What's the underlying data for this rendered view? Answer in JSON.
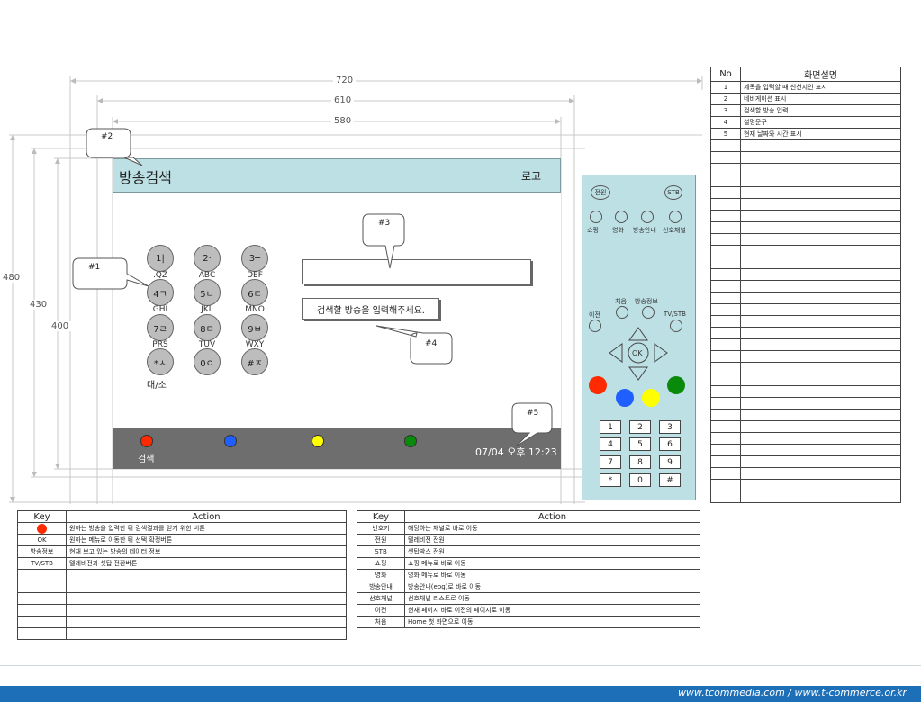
{
  "dimensions": {
    "w720": "720",
    "w610": "610",
    "w580": "580",
    "h480": "480",
    "h430": "430",
    "h400": "400"
  },
  "callouts": {
    "c1": "#1",
    "c2": "#2",
    "c3": "#3",
    "c4": "#4",
    "c5": "#5"
  },
  "screen": {
    "title": "방송검색",
    "logo": "로고",
    "keypad": [
      {
        "key": "1|",
        "sub": ".QZ"
      },
      {
        "key": "2·",
        "sub": "ABC"
      },
      {
        "key": "3─",
        "sub": "DEF"
      },
      {
        "key": "4ㄱ",
        "sub": "GHI"
      },
      {
        "key": "5ㄴ",
        "sub": "JKL"
      },
      {
        "key": "6ㄷ",
        "sub": "MNO"
      },
      {
        "key": "7ㄹ",
        "sub": "PRS"
      },
      {
        "key": "8ㅁ",
        "sub": "TUV"
      },
      {
        "key": "9ㅂ",
        "sub": "WXY"
      },
      {
        "key": "*ㅅ",
        "sub": ""
      },
      {
        "key": "0ㅇ",
        "sub": ""
      },
      {
        "key": "#ㅈ",
        "sub": ""
      }
    ],
    "case_toggle": "대/소",
    "input_value": "",
    "guide_text": "검색할 방송을 입력해주세요.",
    "footer_search_label": "검색",
    "datetime": "07/04 오후 12:23",
    "colors": {
      "red": "#ff2a00",
      "blue": "#1f5fff",
      "yellow": "#ffff00",
      "green": "#0a8a0a",
      "header": "#bde0e5",
      "footer": "#6e6e6e"
    }
  },
  "remote": {
    "power": "전원",
    "stb": "STB",
    "shortcuts": [
      "쇼핑",
      "영화",
      "방송안내",
      "선호채널"
    ],
    "home": "처음",
    "info": "방송정보",
    "back": "이전",
    "tvstb": "TV/STB",
    "ok": "OK",
    "numbers": [
      "1",
      "2",
      "3",
      "4",
      "5",
      "6",
      "7",
      "8",
      "9",
      "*",
      "0",
      "#"
    ]
  },
  "description_table": {
    "headers": [
      "No",
      "화면설명"
    ],
    "rows": [
      [
        "1",
        "제목을 입력할 때 신천지인 표시"
      ],
      [
        "2",
        "네비게이션 표시"
      ],
      [
        "3",
        "검색할 방송 입력"
      ],
      [
        "4",
        "설명문구"
      ],
      [
        "5",
        "현재 날짜와 시간 표시"
      ]
    ],
    "empty_rows": 31
  },
  "key_table_left": {
    "headers": [
      "Key",
      "Action"
    ],
    "rows": [
      [
        "",
        "원하는 방송을 입력한 뒤 검색결과를 얻기 위한 버튼"
      ],
      [
        "OK",
        "원하는 메뉴로 이동한 뒤 선택 확정버튼"
      ],
      [
        "방송정보",
        "현재 보고 있는 방송의 데이터 정보"
      ],
      [
        "TV/STB",
        "텔레비전과 셋탑 전환버튼"
      ]
    ],
    "empty_rows": 6
  },
  "key_table_right": {
    "headers": [
      "Key",
      "Action"
    ],
    "rows": [
      [
        "번호키",
        "해당하는 채널로 바로 이동"
      ],
      [
        "전원",
        "텔레비전 전원"
      ],
      [
        "STB",
        "셋탑박스 전원"
      ],
      [
        "쇼핑",
        "쇼핑 메뉴로 바로 이동"
      ],
      [
        "영화",
        "영화 메뉴로 바로 이동"
      ],
      [
        "방송안내",
        "방송안내(epg)로 바로 이동"
      ],
      [
        "선호채널",
        "선호채널 리스트로 이동"
      ],
      [
        "이전",
        "현재 페이지 바로 이전의 페이지로 이동"
      ],
      [
        "처음",
        "Home 첫 화면으로 이동"
      ]
    ]
  },
  "footer": {
    "url": "www.tcommedia.com / www.t-commerce.or.kr"
  }
}
